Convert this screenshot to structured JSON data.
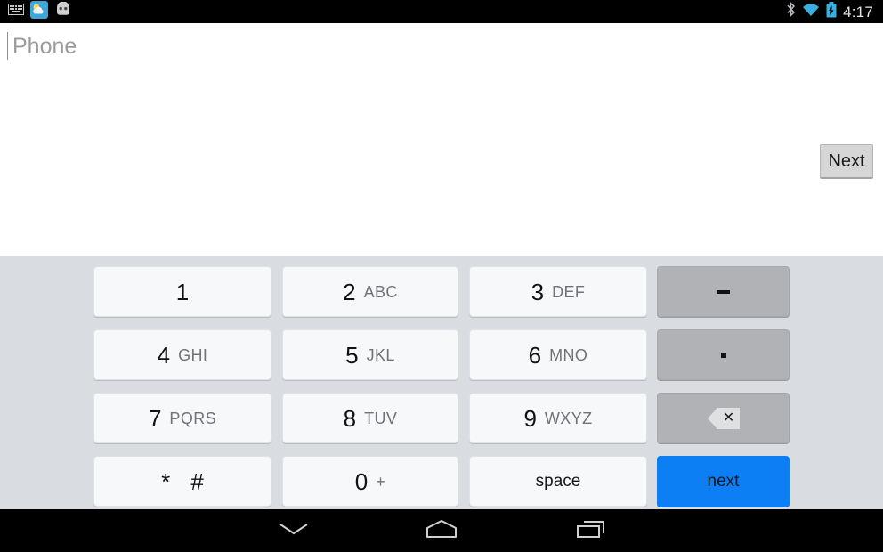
{
  "status_bar": {
    "notifications": [
      {
        "name": "keyboard-icon",
        "label": "keyboard"
      },
      {
        "name": "weather-icon",
        "label": "weather"
      },
      {
        "name": "android-icon",
        "label": "android"
      }
    ],
    "indicators": [
      {
        "name": "bluetooth-icon",
        "label": "bluetooth"
      },
      {
        "name": "wifi-icon",
        "label": "wifi"
      },
      {
        "name": "battery-charging-icon",
        "label": "battery charging"
      }
    ],
    "clock": "4:17"
  },
  "compose": {
    "field_name": "phone",
    "placeholder": "Phone",
    "value": "",
    "underline_color": "#1a9ad4"
  },
  "actions": {
    "next_label": "Next"
  },
  "keyboard": {
    "background_color": "#d9dce0",
    "accent_color": "#0c7ff5",
    "rows": [
      [
        {
          "digit": "1",
          "letters": "",
          "style": "light"
        },
        {
          "digit": "2",
          "letters": "ABC",
          "style": "light"
        },
        {
          "digit": "3",
          "letters": "DEF",
          "style": "light"
        },
        {
          "glyph": "dash",
          "label": "-",
          "style": "dark"
        }
      ],
      [
        {
          "digit": "4",
          "letters": "GHI",
          "style": "light"
        },
        {
          "digit": "5",
          "letters": "JKL",
          "style": "light"
        },
        {
          "digit": "6",
          "letters": "MNO",
          "style": "light"
        },
        {
          "glyph": "dot",
          "label": ".",
          "style": "dark"
        }
      ],
      [
        {
          "digit": "7",
          "letters": "PQRS",
          "style": "light"
        },
        {
          "digit": "8",
          "letters": "TUV",
          "style": "light"
        },
        {
          "digit": "9",
          "letters": "WXYZ",
          "style": "light"
        },
        {
          "glyph": "backspace",
          "label": "delete",
          "style": "dark"
        }
      ],
      [
        {
          "symbol": "* #",
          "style": "light"
        },
        {
          "digit": "0",
          "letters": "+",
          "style": "light"
        },
        {
          "word": "space",
          "style": "light"
        },
        {
          "word": "next",
          "style": "accent"
        }
      ]
    ]
  },
  "nav_bar": {
    "buttons": [
      {
        "name": "hide-keyboard-icon",
        "label": "hide keyboard"
      },
      {
        "name": "home-icon",
        "label": "home"
      },
      {
        "name": "recents-icon",
        "label": "recent apps"
      }
    ]
  }
}
